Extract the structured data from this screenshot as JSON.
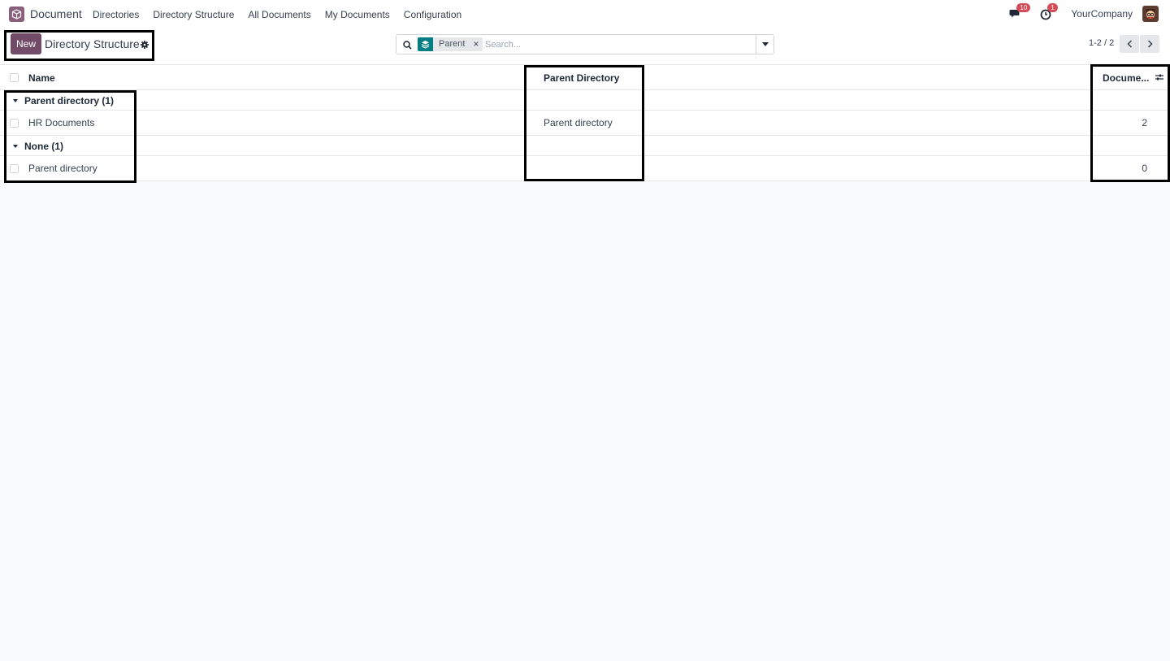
{
  "navbar": {
    "app_name": "Document",
    "menu": [
      "Directories",
      "Directory Structure",
      "All Documents",
      "My Documents",
      "Configuration"
    ],
    "messages_count": "10",
    "activities_count": "1",
    "company": "YourCompany"
  },
  "control": {
    "new_label": "New",
    "breadcrumb": "Directory Structure",
    "search": {
      "facet_label": "Parent",
      "facet_remove": "×",
      "placeholder": "Search..."
    },
    "pager": "1-2 / 2"
  },
  "list": {
    "columns": {
      "name": "Name",
      "parent": "Parent Directory",
      "documents": "Docume..."
    },
    "groups": [
      {
        "label": "Parent directory (1)",
        "rows": [
          {
            "name": "HR Documents",
            "parent": "Parent directory",
            "documents": "2"
          }
        ]
      },
      {
        "label": "None (1)",
        "rows": [
          {
            "name": "Parent directory",
            "parent": "",
            "documents": "0"
          }
        ]
      }
    ]
  },
  "colors": {
    "brand": "#714b67",
    "facet": "#017e84",
    "badge": "#d44c59"
  }
}
